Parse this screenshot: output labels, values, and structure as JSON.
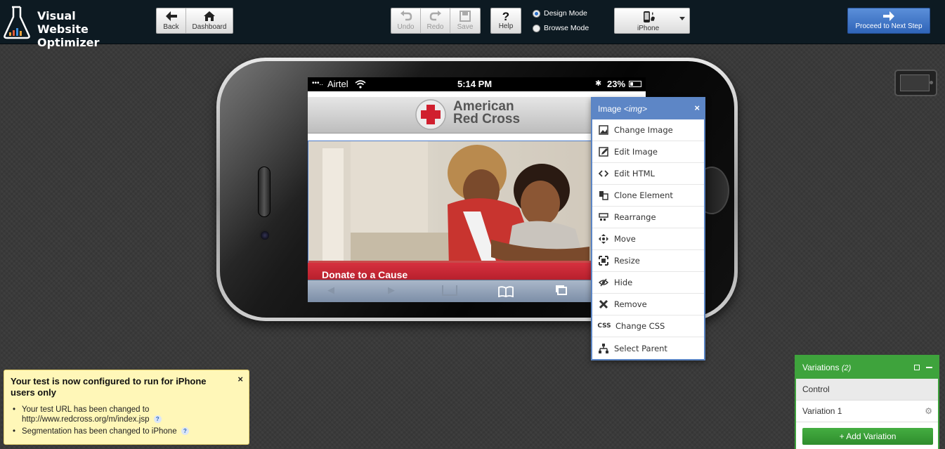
{
  "app": {
    "logo_line1": "Visual Website",
    "logo_line2": "Optimizer"
  },
  "toolbar": {
    "back_label": "Back",
    "dashboard_label": "Dashboard",
    "undo_label": "Undo",
    "redo_label": "Redo",
    "save_label": "Save",
    "help_label": "Help",
    "design_mode_label": "Design Mode",
    "browse_mode_label": "Browse Mode",
    "selected_mode": "Design Mode",
    "device_label": "iPhone",
    "proceed_label": "Proceed to Next Step"
  },
  "phone": {
    "carrier": "Airtel",
    "time": "5:14 PM",
    "battery": "23%",
    "brand_line1": "American",
    "brand_line2": "Red Cross",
    "donate_text": "Donate to a Cause"
  },
  "context_menu": {
    "title": "Image",
    "title_tag": "<img>",
    "close": "×",
    "items": [
      {
        "label": "Change Image",
        "icon": "change-image-icon"
      },
      {
        "label": "Edit Image",
        "icon": "edit-image-icon"
      },
      {
        "label": "Edit HTML",
        "icon": "code-icon"
      },
      {
        "label": "Clone Element",
        "icon": "clone-icon"
      },
      {
        "label": "Rearrange",
        "icon": "rearrange-icon"
      },
      {
        "label": "Move",
        "icon": "move-icon"
      },
      {
        "label": "Resize",
        "icon": "resize-icon"
      },
      {
        "label": "Hide",
        "icon": "hide-icon"
      },
      {
        "label": "Remove",
        "icon": "remove-icon"
      },
      {
        "label": "Change CSS",
        "icon": "css-icon"
      },
      {
        "label": "Select Parent",
        "icon": "select-parent-icon"
      }
    ]
  },
  "notice": {
    "title": "Your test is now configured to run for iPhone users only",
    "close": "×",
    "line1": "Your test URL has been changed to",
    "line1_url": "http://www.redcross.org/m/index.jsp",
    "line2": "Segmentation has been changed to iPhone",
    "help": "?"
  },
  "variations": {
    "title": "Variations",
    "count": "(2)",
    "items": [
      "Control",
      "Variation 1"
    ],
    "add_label": "+ Add Variation"
  },
  "colors": {
    "topbar": "#0d1a22",
    "accent_blue": "#5d86c6",
    "accent_green": "#3ea33c",
    "redcross_red": "#d01f2e",
    "notice_bg": "#fff7b8"
  }
}
